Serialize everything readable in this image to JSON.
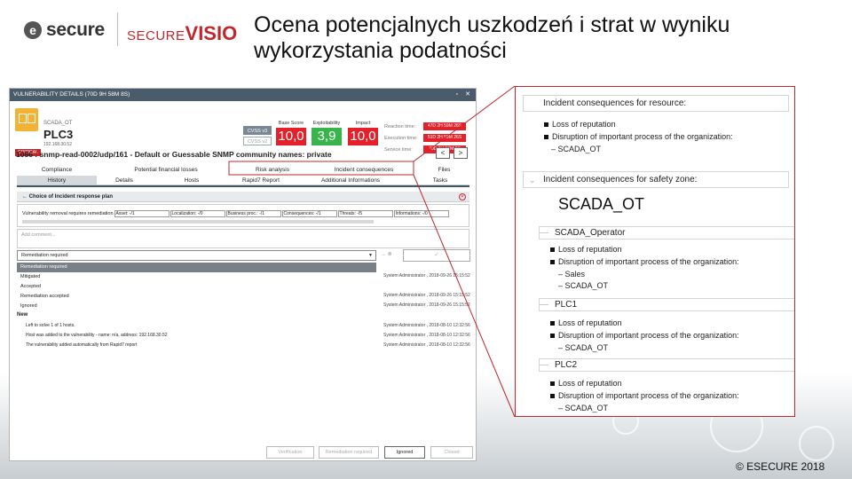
{
  "slide": {
    "title": "Ocena potencjalnych uszkodzeń i strat w wyniku wykorzystania podatności",
    "logo_esecure": "secure",
    "logo_esecure_mark": "e",
    "logo_securevisio_a": "SECURE",
    "logo_securevisio_b": "VISIO",
    "copyright": "© ESECURE 2018"
  },
  "window": {
    "title": "VULNERABILITY DETAILS (70D 9H 58M 8S)",
    "asset_type": "SCADA_OT",
    "asset_name": "PLC3",
    "asset_ip": "192.168.30.52",
    "criticality": "CRITICAL",
    "cvss_a": "CVSS v3",
    "cvss_b": "CVSS v2",
    "scores": [
      {
        "label": "Base Score",
        "value": "10,0",
        "color": "#e4212a"
      },
      {
        "label": "Exploitability",
        "value": "3,9",
        "color": "#38b54a"
      },
      {
        "label": "Impact",
        "value": "10,0",
        "color": "#e4212a"
      }
    ],
    "times": [
      {
        "label": "Reaction time:",
        "value": "47D 2H 59M 26S"
      },
      {
        "label": "Execution time:",
        "value": "51D 2H 59M 26S"
      },
      {
        "label": "Service time:",
        "value": "70D 9H 58M 8S"
      }
    ],
    "vuln_title": "1086 : snmp-read-0002/udp/161  -  Default or Guessable SNMP community names: private",
    "nav_prev": "<",
    "nav_next": ">",
    "tabs_row1": [
      "Compliance",
      "Potential financial losses",
      "Risk analysis",
      "Incident consequences",
      "Files"
    ],
    "tabs_row2": [
      "History",
      "Details",
      "Hosts",
      "Rapid7 Report",
      "Additional Informations",
      "Tasks"
    ],
    "plan_title": "Choice of Incident response plan",
    "removal_label": "Vulnerability removal requires remediation",
    "removal_fields": [
      "Asset: -/1",
      "Localization: -/0",
      "Business proc.: -/1",
      "Consequences: -/1",
      "Threats: -/5",
      "Informations: -/0"
    ],
    "comment_placeholder": "Add comment...",
    "dropdown_value": "Remediation required",
    "dropdown_options": [
      "Remediation required",
      "Mitigated",
      "Accepted",
      "Remediation accepted",
      "Ignored"
    ],
    "dropdown_icons": "→ ⊗",
    "ok_label": "✓",
    "history_top": [
      {
        "who": "System Administrator ,  2018-09-26 15:15:52"
      },
      {
        "who": "System Administrator ,  2018-09-26 15:15:52"
      },
      {
        "who": "System Administrator ,  2018-09-26 15:15:52"
      }
    ],
    "history_new_label": "New",
    "history_new": [
      {
        "text": "Left to solve 1 of 1 hosts.",
        "who": "System Administrator ,  2018-08-10 12:32:56"
      },
      {
        "text": "Host was added to the vulnerability - name: n/a, address: 192.168.30.52",
        "who": "System Administrator ,  2018-08-10 12:32:56"
      },
      {
        "text": "The vulnerability added automatically from Rapid7 report",
        "who": "System Administrator ,  2018-08-10 12:32:56"
      }
    ],
    "footer_buttons": [
      "Verification",
      "Remediation required",
      "Ignored",
      "Closed"
    ]
  },
  "zoom": {
    "resource_title": "Incident consequences for resource:",
    "resource_items": [
      "Loss of reputation",
      "Disruption of important process of the organization:"
    ],
    "resource_sub": [
      "SCADA_OT"
    ],
    "zone_title": "Incident consequences for safety zone:",
    "zone_name": "SCADA_OT",
    "groups": [
      {
        "name": "SCADA_Operator",
        "items": [
          "Loss of reputation",
          "Disruption of important process of the organization:"
        ],
        "sub": [
          "Sales",
          "SCADA_OT"
        ]
      },
      {
        "name": "PLC1",
        "items": [
          "Loss of reputation",
          "Disruption of important process of the organization:"
        ],
        "sub": [
          "SCADA_OT"
        ]
      },
      {
        "name": "PLC2",
        "items": [
          "Loss of reputation",
          "Disruption of important process of the organization:"
        ],
        "sub": [
          "SCADA_OT"
        ]
      }
    ],
    "dash": "–"
  },
  "colors": {
    "accent": "#c0272d",
    "header": "#4a5b6b",
    "danger": "#e4212a",
    "ok": "#38b54a"
  },
  "icons": {
    "close": "close-icon",
    "maximize": "maximize-icon",
    "plc": "plc-icon",
    "chevron": "chevron-down-icon",
    "chevron_glyph": "⌄"
  }
}
